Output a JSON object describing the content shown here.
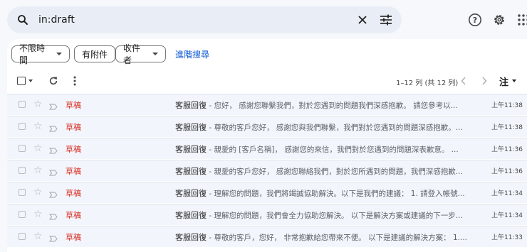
{
  "search": {
    "query": "in:draft"
  },
  "filters": {
    "chips": [
      "不限時間",
      "有附件",
      "收件者"
    ],
    "advanced_search": "進階搜尋"
  },
  "toolbar": {
    "page_info": "1–12 列 (共 12 列)",
    "sort_label": "注"
  },
  "emails": [
    {
      "sender": "草稿",
      "subject": "客服回復",
      "snippet": "您好， 感謝您聯繫我們，對於您遇到的問題我們深感抱歉。 請您參考以...",
      "time": "上午11:38"
    },
    {
      "sender": "草稿",
      "subject": "客服回復",
      "snippet": "尊敬的客戶您好， 感謝您與我們聯繫，我們對於您遇到的問題深感抱歉。...",
      "time": "上午11:38"
    },
    {
      "sender": "草稿",
      "subject": "客服回復",
      "snippet": "親愛的 [客戶名稱]， 感謝您的來信，我們對於您遇到的問題深表歉意。 ...",
      "time": "上午11:36"
    },
    {
      "sender": "草稿",
      "subject": "客服回復",
      "snippet": "親愛的客戶您好， 感謝您聯絡我們，對於您所遇到的問題，我們深感抱歉...",
      "time": "上午11:36"
    },
    {
      "sender": "草稿",
      "subject": "客服回復",
      "snippet": "理解您的問題，我們將竭誠協助解決。以下是我們的建議： 1. 請登入帳號...",
      "time": "上午11:34"
    },
    {
      "sender": "草稿",
      "subject": "客服回復",
      "snippet": "理解您的問題，我們會全力協助您解決。 以下是解決方案或建議的下一步...",
      "time": "上午11:34"
    },
    {
      "sender": "草稿",
      "subject": "客服回復",
      "snippet": "尊敬的客戶，您好， 非常抱歉給您帶來不便。 以下是建議的解決方案： 1....",
      "time": "上午11:33"
    }
  ],
  "colors": {
    "draft_label": "#d93025",
    "link": "#0b57d0",
    "search_bg": "#e9eef6",
    "row_bg": "#f2f6fc"
  },
  "icons": [
    "search-icon",
    "clear-icon",
    "search-options-icon",
    "help-icon",
    "settings-icon",
    "apps-icon",
    "select-all-icon",
    "refresh-icon",
    "more-icon",
    "prev-page-icon",
    "next-page-icon",
    "star-icon",
    "important-icon"
  ]
}
